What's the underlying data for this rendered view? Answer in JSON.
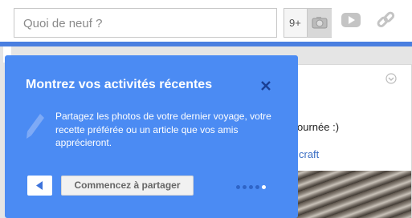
{
  "compose": {
    "placeholder": "Quoi de neuf ?",
    "badge": "9+",
    "icons": [
      "camera-icon",
      "youtube-icon",
      "link-icon"
    ]
  },
  "onboarding": {
    "title": "Montrez vos activités récentes",
    "body": "Partagez les photos de votre dernier voyage, votre recette préférée ou un article que vos amis apprécieront.",
    "share_label": "Commencez à partager",
    "dots_total": 5,
    "active_dot": 5
  },
  "card": {
    "text_fragment": "ournée :)",
    "link_fragment": "craft"
  },
  "colors": {
    "panel_blue": "#4b8bf3",
    "accent_bar": "#4a7fe0",
    "dot_inactive": "#2e64c7",
    "link_blue": "#3a6ec4"
  }
}
